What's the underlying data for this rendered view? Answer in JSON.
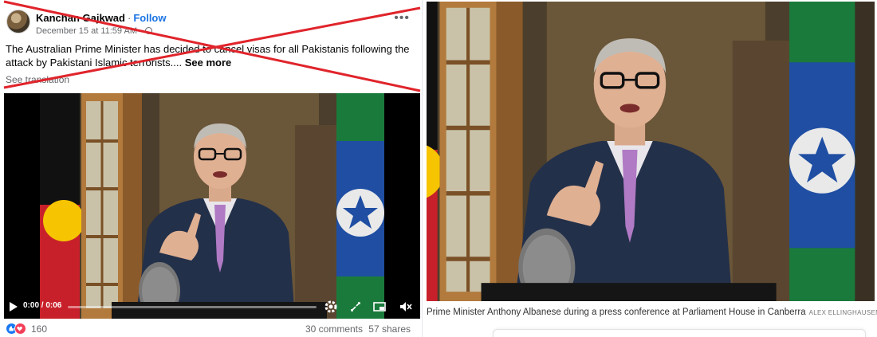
{
  "post": {
    "author": "Kanchan Gajkwad",
    "separator": "·",
    "follow_label": "Follow",
    "timestamp": "December 15 at 11:59 AM ·",
    "text": "The Australian Prime Minister has decided to cancel visas for all Pakistanis following the attack by Pakistani Islamic terrorists....",
    "see_more": "See more",
    "see_translation": "See translation",
    "more_options_icon": "more-options-icon"
  },
  "video": {
    "time": "0:00 / 0:06",
    "progress": 0,
    "icons": [
      "play-icon",
      "settings-icon",
      "expand-icon",
      "miniplayer-icon",
      "mute-icon"
    ]
  },
  "reactions": {
    "count": "160",
    "comments": "30 comments",
    "shares": "57 shares",
    "icons": [
      "like-icon",
      "love-icon"
    ]
  },
  "news": {
    "caption": "Prime Minister Anthony Albanese during a press conference at Parliament House in Canberra",
    "credit": "ALEX ELLINGHAUSEN"
  },
  "colors": {
    "facebook_blue": "#1b74e4",
    "cross_red": "#e0242b",
    "meta_gray": "#65676b"
  }
}
